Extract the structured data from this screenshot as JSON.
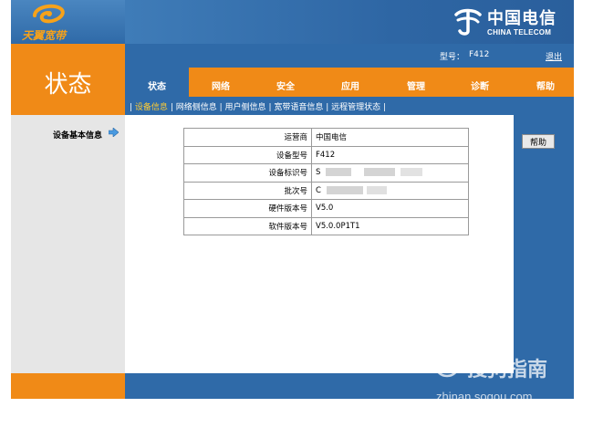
{
  "brand": {
    "name": "天翼宽带"
  },
  "telecom": {
    "name_cn": "中国电信",
    "name_en": "CHINA TELECOM"
  },
  "page_title": "状态",
  "topbar": {
    "model_label": "型号：",
    "model_value": "F412",
    "logout": "退出"
  },
  "nav": {
    "items": [
      {
        "label": "状态"
      },
      {
        "label": "网络"
      },
      {
        "label": "安全"
      },
      {
        "label": "应用"
      },
      {
        "label": "管理"
      },
      {
        "label": "诊断"
      },
      {
        "label": "帮助"
      }
    ]
  },
  "subnav": {
    "items": [
      {
        "label": "设备信息"
      },
      {
        "label": "网络侧信息"
      },
      {
        "label": "用户侧信息"
      },
      {
        "label": "宽带语音信息"
      },
      {
        "label": "远程管理状态"
      }
    ]
  },
  "sidebar": {
    "label": "设备基本信息",
    "arrow_icon": "arrow-right-icon"
  },
  "help_button": "帮助",
  "table": {
    "rows": [
      {
        "key": "运营商",
        "value": "中国电信"
      },
      {
        "key": "设备型号",
        "value": "F412"
      },
      {
        "key": "设备标识号",
        "value": "S"
      },
      {
        "key": "批次号",
        "value": "C"
      },
      {
        "key": "硬件版本号",
        "value": "V5.0"
      },
      {
        "key": "软件版本号",
        "value": "V5.0.0P1T1"
      }
    ]
  },
  "watermark": {
    "text": "搜狗指南",
    "url": "zhinan.sogou.com"
  },
  "colors": {
    "orange": "#f08a17",
    "blue": "#2f6aa8",
    "active_subnav": "#ffcc33"
  }
}
